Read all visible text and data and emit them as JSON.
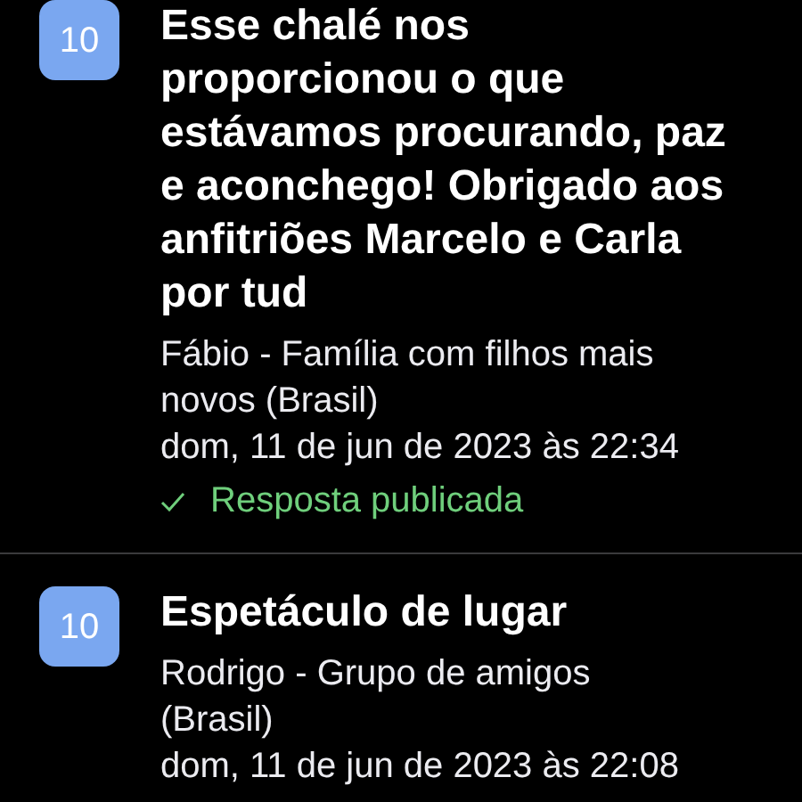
{
  "reviews": [
    {
      "score": "10",
      "title": "Esse chalé nos proporcionou o que estávamos procurando, paz e aconchego! Obrigado aos anfitriões Marcelo e Carla por tud",
      "author": "Fábio - Família com filhos mais novos (Brasil)",
      "date": "dom, 11 de jun de 2023 às 22:34",
      "response": {
        "text": "Resposta publicada",
        "published": true
      }
    },
    {
      "score": "10",
      "title": "Espetáculo de lugar",
      "author": "Rodrigo - Grupo de amigos (Brasil)",
      "date": "dom, 11 de jun de 2023 às 22:08"
    }
  ]
}
